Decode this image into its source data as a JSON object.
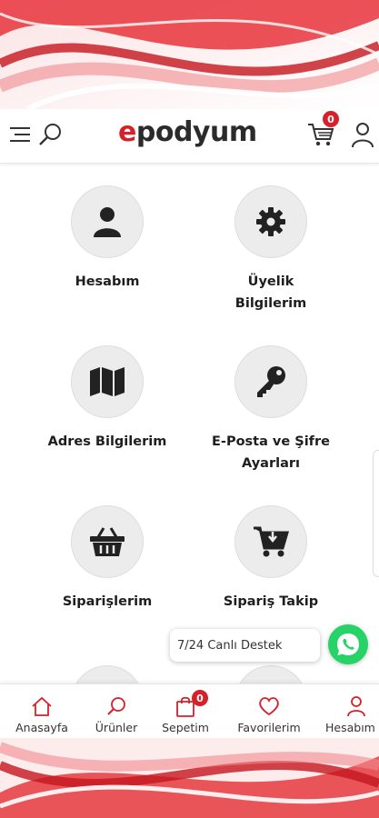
{
  "header": {
    "logo_prefix": "e",
    "logo_rest": "podyum",
    "cart_count": "0"
  },
  "menu": [
    {
      "label": "Hesabım",
      "icon": "user-icon"
    },
    {
      "label": "Üyelik\nBilgilerim",
      "icon": "gear-icon"
    },
    {
      "label": "Adres Bilgilerim",
      "icon": "map-icon"
    },
    {
      "label": "E-Posta ve Şifre\nAyarları",
      "icon": "key-icon"
    },
    {
      "label": "Siparişlerim",
      "icon": "basket-icon"
    },
    {
      "label": "Sipariş Takip",
      "icon": "cart-download-icon"
    },
    {
      "label": "",
      "icon": "gift-icon"
    },
    {
      "label": "",
      "icon": "heart-icon"
    }
  ],
  "chat": {
    "label": "7/24 Canlı Destek"
  },
  "bottom_nav": [
    {
      "label": "Anasayfa",
      "icon": "home-icon"
    },
    {
      "label": "Ürünler",
      "icon": "search-icon"
    },
    {
      "label": "Sepetim",
      "icon": "bag-icon",
      "badge": "0"
    },
    {
      "label": "Favorilerim",
      "icon": "heart-icon"
    },
    {
      "label": "Hesabım",
      "icon": "user-icon"
    }
  ],
  "colors": {
    "accent": "#d6202a",
    "circle_bg": "#ececec",
    "whatsapp": "#25d366"
  }
}
